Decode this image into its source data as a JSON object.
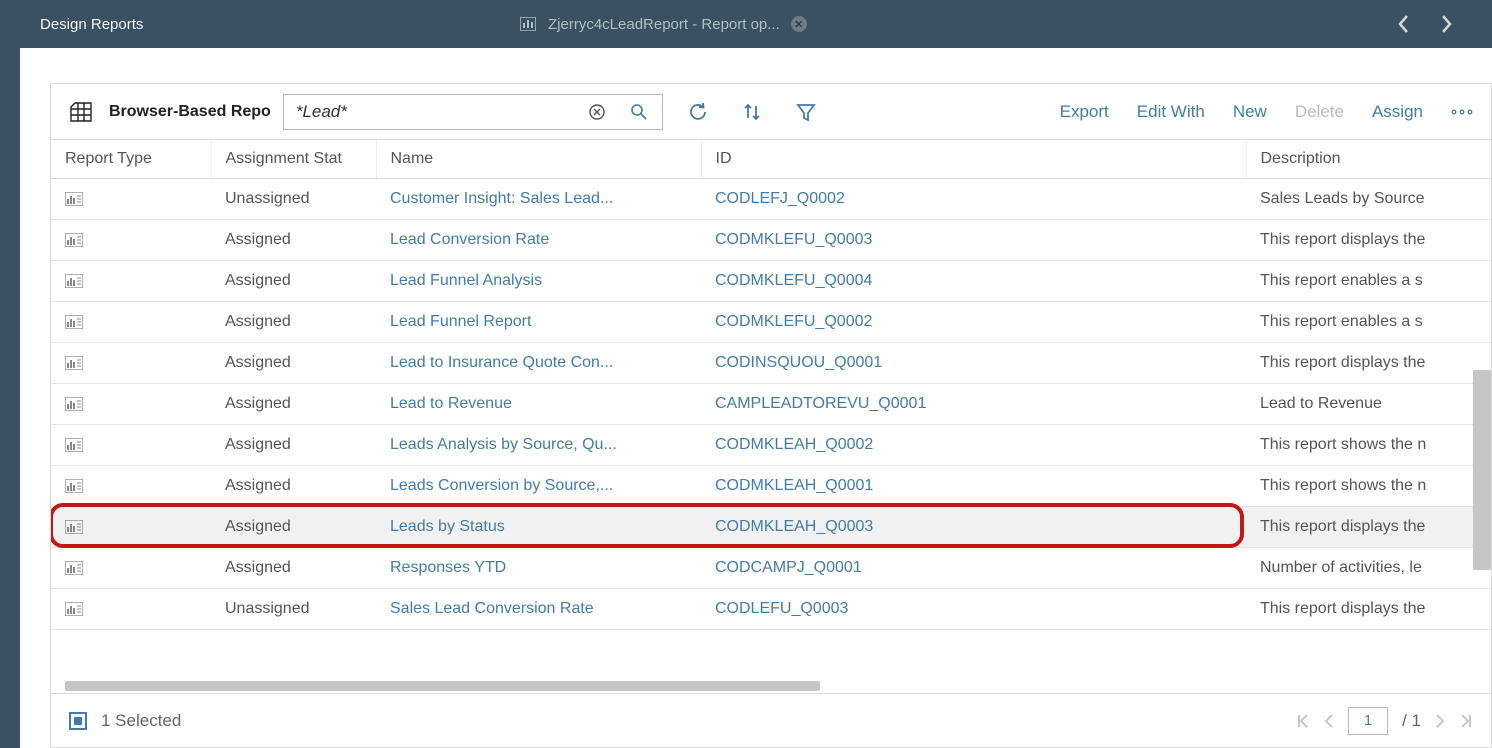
{
  "header": {
    "primary_tab": "Design Reports",
    "secondary_tab": "Zjerryc4cLeadReport - Report op..."
  },
  "toolbar": {
    "title": "Browser-Based Repo",
    "search_value": "*Lead*",
    "actions": {
      "export": "Export",
      "edit_with": "Edit With",
      "new": "New",
      "delete": "Delete",
      "assign": "Assign"
    }
  },
  "columns": {
    "type": "Report Type",
    "status": "Assignment Stat",
    "name": "Name",
    "id": "ID",
    "desc": "Description"
  },
  "rows": [
    {
      "status": "Unassigned",
      "name": "Customer Insight: Sales Lead...",
      "rid": "CODLEFJ_Q0002",
      "desc": "Sales Leads by Source",
      "selected": false
    },
    {
      "status": "Assigned",
      "name": "Lead Conversion Rate",
      "rid": "CODMKLEFU_Q0003",
      "desc": "This report displays the",
      "selected": false
    },
    {
      "status": "Assigned",
      "name": "Lead Funnel Analysis",
      "rid": "CODMKLEFU_Q0004",
      "desc": "This report enables a s",
      "selected": false
    },
    {
      "status": "Assigned",
      "name": "Lead Funnel Report",
      "rid": "CODMKLEFU_Q0002",
      "desc": "This report enables a s",
      "selected": false
    },
    {
      "status": "Assigned",
      "name": "Lead to Insurance Quote Con...",
      "rid": "CODINSQUOU_Q0001",
      "desc": "This report displays the",
      "selected": false
    },
    {
      "status": "Assigned",
      "name": "Lead to Revenue",
      "rid": "CAMPLEADTOREVU_Q0001",
      "desc": "Lead to Revenue",
      "selected": false
    },
    {
      "status": "Assigned",
      "name": "Leads Analysis by Source, Qu...",
      "rid": "CODMKLEAH_Q0002",
      "desc": "This report shows the n",
      "selected": false
    },
    {
      "status": "Assigned",
      "name": "Leads Conversion by Source,...",
      "rid": "CODMKLEAH_Q0001",
      "desc": "This report shows the n",
      "selected": false
    },
    {
      "status": "Assigned",
      "name": "Leads by Status",
      "rid": "CODMKLEAH_Q0003",
      "desc": "This report displays the",
      "selected": true
    },
    {
      "status": "Assigned",
      "name": "Responses YTD",
      "rid": "CODCAMPJ_Q0001",
      "desc": "Number of activities, le",
      "selected": false
    },
    {
      "status": "Unassigned",
      "name": "Sales Lead Conversion Rate",
      "rid": "CODLEFU_Q0003",
      "desc": "This report displays the",
      "selected": false
    }
  ],
  "footer": {
    "selected_text": "1 Selected",
    "page_current": "1",
    "page_total": "/ 1"
  }
}
